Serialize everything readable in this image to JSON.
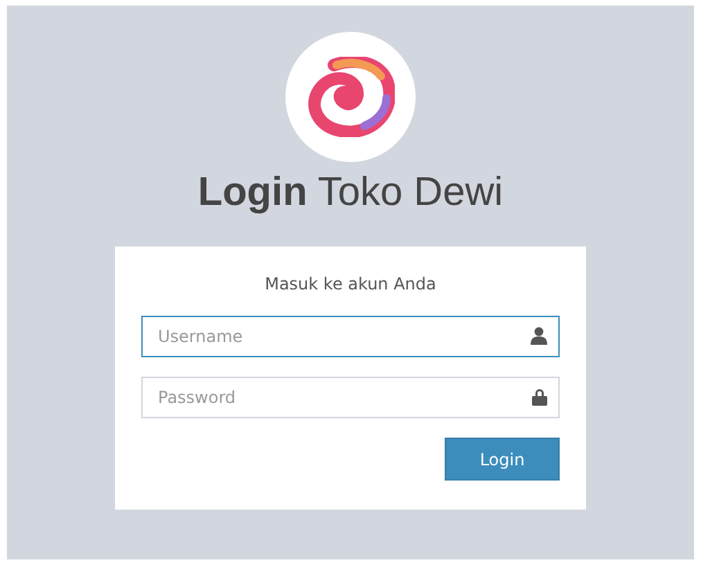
{
  "header": {
    "title_bold": "Login",
    "title_rest": "Toko Dewi"
  },
  "form": {
    "subtitle": "Masuk ke akun Anda",
    "fields": [
      {
        "kind": "user",
        "placeholder": "Username",
        "focused": true
      },
      {
        "kind": "lock",
        "placeholder": "Password",
        "focused": false
      }
    ],
    "button": "Login"
  }
}
